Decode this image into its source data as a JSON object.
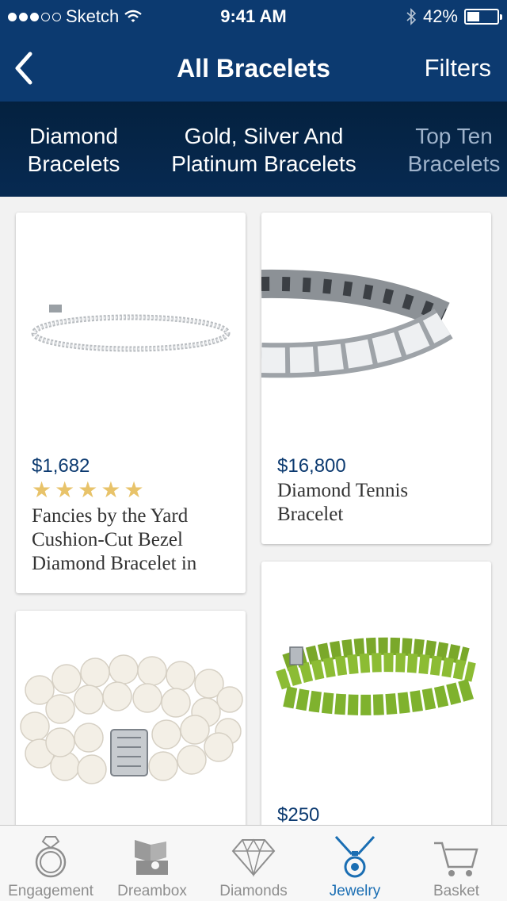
{
  "status_bar": {
    "carrier": "Sketch",
    "time": "9:41 AM",
    "battery": "42%",
    "battery_level": 0.42,
    "signal_bars_filled": 3,
    "signal_bars_total": 5
  },
  "nav": {
    "title": "All Bracelets",
    "filters_label": "Filters"
  },
  "categories": [
    {
      "line1": "Diamond",
      "line2": "Bracelets"
    },
    {
      "line1": "Gold, Silver And",
      "line2": "Platinum Bracelets"
    },
    {
      "line1": "Top Ten",
      "line2": "Bracelets"
    }
  ],
  "products": [
    {
      "price": "$1,682",
      "rating": 5,
      "name": "Fancies by the Yard Cushion-Cut Bezel Diamond Bracelet in"
    },
    {
      "price": "$16,800",
      "name": "Diamond Tennis Bracelet"
    },
    {
      "price": "",
      "name": ""
    },
    {
      "price": "$250",
      "name": ""
    }
  ],
  "tabs": [
    {
      "label": "Engagement",
      "icon": "ring-icon",
      "active": false
    },
    {
      "label": "Dreambox",
      "icon": "dreambox-icon",
      "active": false
    },
    {
      "label": "Diamonds",
      "icon": "diamond-icon",
      "active": false
    },
    {
      "label": "Jewelry",
      "icon": "necklace-icon",
      "active": true
    },
    {
      "label": "Basket",
      "icon": "cart-icon",
      "active": false
    }
  ],
  "colors": {
    "header_bg": "#0c3a70",
    "accent": "#1a6eb3",
    "star": "#e8c36a"
  }
}
